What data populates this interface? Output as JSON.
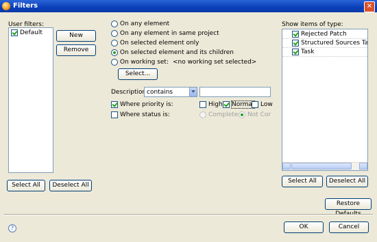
{
  "window": {
    "title": "Filters",
    "close_glyph": "✕"
  },
  "user_filters": {
    "label": "User filters:",
    "items": [
      {
        "label": "Default",
        "checked": true
      }
    ],
    "new_button": "New",
    "remove_button": "Remove",
    "select_all": "Select All",
    "deselect_all": "Deselect All"
  },
  "scope": {
    "options": [
      "On any element",
      "On any element in same project",
      "On selected element only",
      "On selected element and its children",
      "On working set:"
    ],
    "selected_index": 3,
    "working_set_value": "<no working set selected>",
    "select_button": "Select..."
  },
  "description": {
    "label": "Description",
    "operator": "contains",
    "value": ""
  },
  "priority": {
    "label": "Where priority is:",
    "checked": true,
    "options": [
      {
        "label": "High",
        "checked": false
      },
      {
        "label": "Normal",
        "checked": true
      },
      {
        "label": "Low",
        "checked": false
      }
    ]
  },
  "status": {
    "label": "Where status is:",
    "checked": false,
    "options": [
      "Completed",
      "Not Comp"
    ]
  },
  "types": {
    "label": "Show items of type:",
    "items": [
      {
        "label": "Rejected Patch",
        "checked": true
      },
      {
        "label": "Structured Sources Task",
        "checked": true
      },
      {
        "label": "Task",
        "checked": true
      }
    ],
    "select_all": "Select All",
    "deselect_all": "Deselect All"
  },
  "restore_defaults": "Restore Defaults",
  "ok": "OK",
  "cancel": "Cancel",
  "help_glyph": "?"
}
